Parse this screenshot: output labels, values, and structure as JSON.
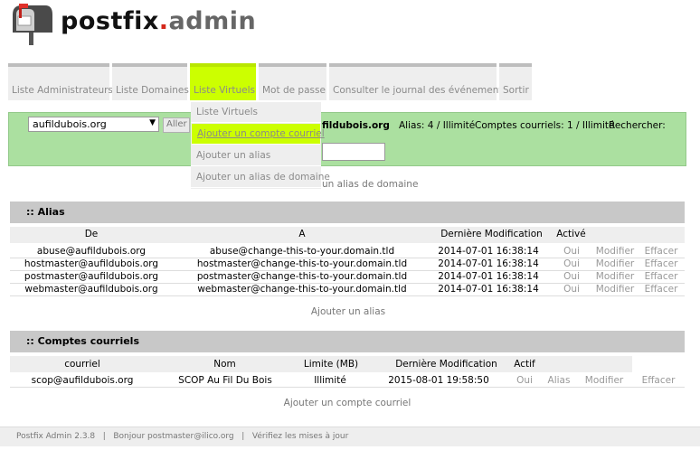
{
  "logo": {
    "part1": "postfix",
    "dot": ".",
    "part2": "admin"
  },
  "menu": [
    {
      "label": "Liste Administrateurs"
    },
    {
      "label": "Liste Domaines"
    },
    {
      "label": "Liste Virtuels"
    },
    {
      "label": "Mot de passe"
    },
    {
      "label": "Consulter le journal des événements"
    },
    {
      "label": "Sortir"
    }
  ],
  "dropdown": [
    {
      "label": "Liste Virtuels"
    },
    {
      "label": "Ajouter un compte courriel"
    },
    {
      "label": "Ajouter un alias"
    },
    {
      "label": "Ajouter un alias de domaine"
    }
  ],
  "toolbar": {
    "domain_value": "aufildubois.org",
    "go_label": "Aller",
    "domain_name_partial": "fildubois.org",
    "alias_stats": "Alias: 4 / Illimité",
    "mailbox_stats": "Comptes courriels: 1 / Illimité",
    "search_label": "Rechercher:",
    "add_domain_alias_partial": "un alias de domaine"
  },
  "alias_section": {
    "title": ":: Alias",
    "headers": [
      "De",
      "A",
      "Dernière Modification",
      "Activé"
    ],
    "rows": [
      {
        "from": "abuse@aufildubois.org",
        "to": "abuse@change-this-to-your.domain.tld",
        "modified": "2014-07-01 16:38:14",
        "active": "Oui",
        "edit": "Modifier",
        "delete": "Effacer"
      },
      {
        "from": "hostmaster@aufildubois.org",
        "to": "hostmaster@change-this-to-your.domain.tld",
        "modified": "2014-07-01 16:38:14",
        "active": "Oui",
        "edit": "Modifier",
        "delete": "Effacer"
      },
      {
        "from": "postmaster@aufildubois.org",
        "to": "postmaster@change-this-to-your.domain.tld",
        "modified": "2014-07-01 16:38:14",
        "active": "Oui",
        "edit": "Modifier",
        "delete": "Effacer"
      },
      {
        "from": "webmaster@aufildubois.org",
        "to": "webmaster@change-this-to-your.domain.tld",
        "modified": "2014-07-01 16:38:14",
        "active": "Oui",
        "edit": "Modifier",
        "delete": "Effacer"
      }
    ],
    "add_link": "Ajouter un alias"
  },
  "mailbox_section": {
    "title": ":: Comptes courriels",
    "headers": [
      "courriel",
      "Nom",
      "Limite (MB)",
      "Dernière Modification",
      "Actif"
    ],
    "rows": [
      {
        "email": "scop@aufildubois.org",
        "name": "SCOP Au Fil Du Bois",
        "quota": "Illimité",
        "modified": "2015-08-01 19:58:50",
        "active": "Oui",
        "alias": "Alias",
        "edit": "Modifier",
        "delete": "Effacer"
      }
    ],
    "add_link": "Ajouter un compte courriel"
  },
  "footer": {
    "version": "Postfix Admin 2.3.8",
    "sep": "|",
    "greeting": "Bonjour postmaster@ilico.org",
    "updates": "Vérifiez les mises à jour"
  },
  "colors": {
    "accent": "#ccff00",
    "toolbar_bg": "#abe0a0",
    "section_bar": "#c8c8c8",
    "logo_dot": "#d4281b"
  }
}
